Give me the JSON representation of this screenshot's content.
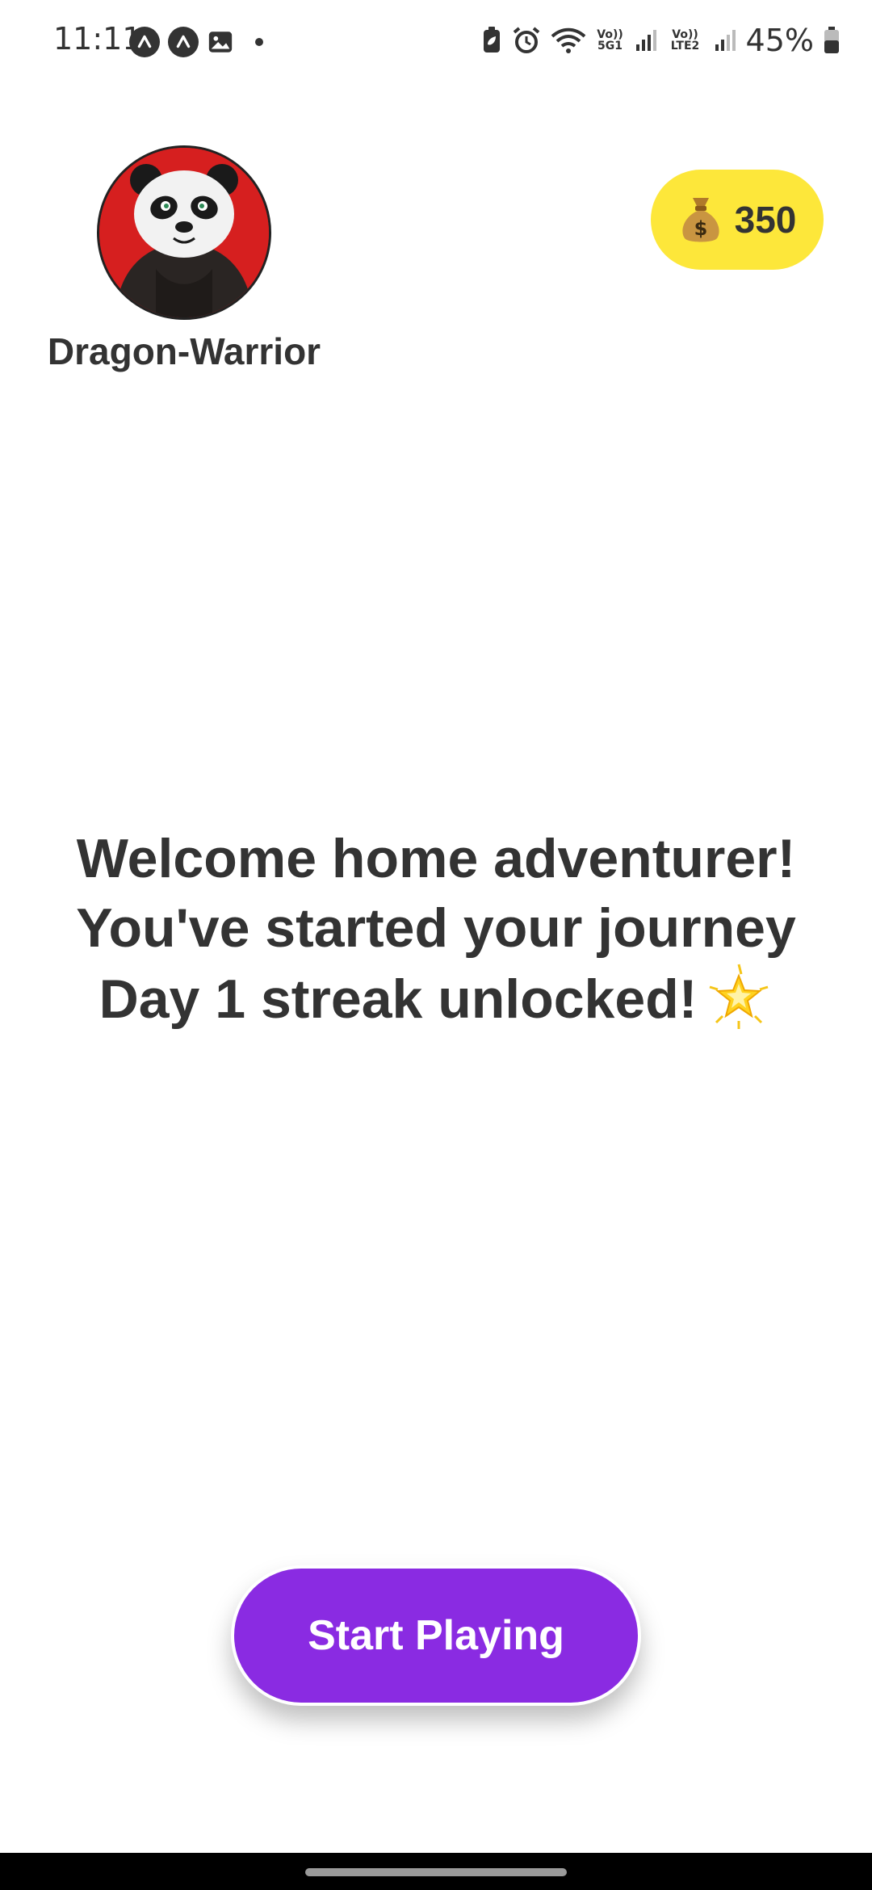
{
  "status_bar": {
    "time": "11:11",
    "battery": "45%",
    "sim1_label": "Vo)) 5G1",
    "sim2_label": "Vo)) LTE2"
  },
  "profile": {
    "username": "Dragon-Warrior",
    "avatar_icon": "panda-avatar"
  },
  "coins": {
    "icon": "money-bag-icon",
    "count": "350",
    "badge_color": "#fde73a"
  },
  "welcome": {
    "line1": "Welcome home adventurer!",
    "line2": "You've started your journey",
    "line3": "Day 1 streak unlocked!",
    "emoji": "glowing-star-icon"
  },
  "cta": {
    "label": "Start Playing",
    "color": "#8a2be2"
  }
}
